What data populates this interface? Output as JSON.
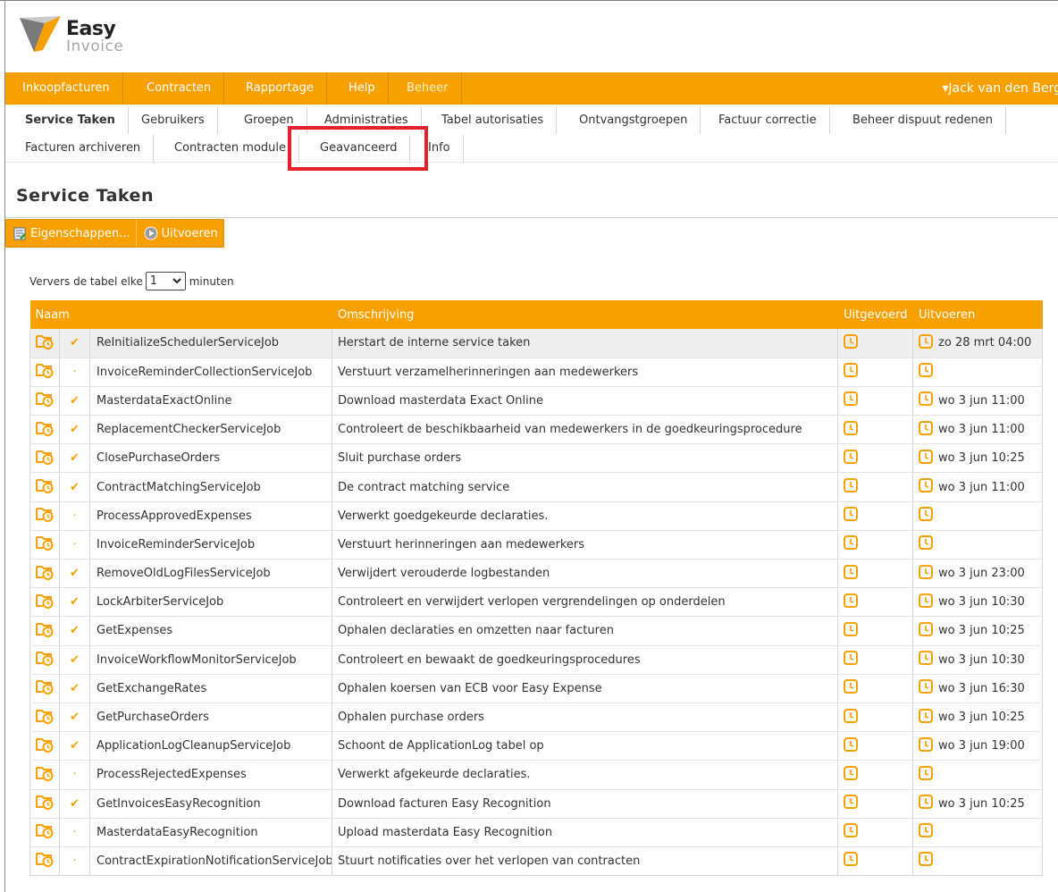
{
  "logo": {
    "line1": "Easy",
    "line2": "Invoice"
  },
  "colors": {
    "accent": "#f7a000",
    "highlight": "#e8202a"
  },
  "topnav": {
    "items": [
      "Inkoopfacturen",
      "Contracten",
      "Rapportage",
      "Help",
      "Beheer"
    ],
    "active": "Beheer",
    "user": "▾Jack van den Berg"
  },
  "subnav": {
    "row1": [
      "Service Taken",
      "Gebruikers",
      "Groepen",
      "Administraties",
      "Tabel autorisaties",
      "Ontvangstgroepen",
      "Factuur correctie",
      "Beheer dispuut redenen"
    ],
    "row2": [
      "Facturen archiveren",
      "Contracten module",
      "Geavanceerd",
      "Info"
    ],
    "active": "Service Taken",
    "highlighted": "Geavanceerd"
  },
  "page": {
    "title": "Service Taken"
  },
  "toolbar": {
    "properties_label": "Eigenschappen...",
    "run_label": "Uitvoeren"
  },
  "refresh": {
    "prefix": "Ververs de tabel elke",
    "value": "1",
    "suffix": "minuten"
  },
  "table": {
    "headers": {
      "name": "Naam",
      "description": "Omschrijving",
      "executed": "Uitgevoerd",
      "run": "Uitvoeren"
    },
    "rows": [
      {
        "enabled": true,
        "name": "ReInitializeSchedulerServiceJob",
        "description": "Herstart de interne service taken",
        "next_run": "zo 28 mrt 04:00"
      },
      {
        "enabled": false,
        "name": "InvoiceReminderCollectionServiceJob",
        "description": "Verstuurt verzamelherinneringen aan medewerkers",
        "next_run": ""
      },
      {
        "enabled": true,
        "name": "MasterdataExactOnline",
        "description": "Download masterdata Exact Online",
        "next_run": "wo 3 jun 11:00"
      },
      {
        "enabled": true,
        "name": "ReplacementCheckerServiceJob",
        "description": "Controleert de beschikbaarheid van medewerkers in de goedkeuringsprocedure",
        "next_run": "wo 3 jun 11:00"
      },
      {
        "enabled": true,
        "name": "ClosePurchaseOrders",
        "description": "Sluit purchase orders",
        "next_run": "wo 3 jun 10:25"
      },
      {
        "enabled": true,
        "name": "ContractMatchingServiceJob",
        "description": "De contract matching service",
        "next_run": "wo 3 jun 11:00"
      },
      {
        "enabled": false,
        "name": "ProcessApprovedExpenses",
        "description": "Verwerkt goedgekeurde declaraties.",
        "next_run": ""
      },
      {
        "enabled": false,
        "name": "InvoiceReminderServiceJob",
        "description": "Verstuurt herinneringen aan medewerkers",
        "next_run": ""
      },
      {
        "enabled": true,
        "name": "RemoveOldLogFilesServiceJob",
        "description": "Verwijdert verouderde logbestanden",
        "next_run": "wo 3 jun 23:00"
      },
      {
        "enabled": true,
        "name": "LockArbiterServiceJob",
        "description": "Controleert en verwijdert verlopen vergrendelingen op onderdelen",
        "next_run": "wo 3 jun 10:30"
      },
      {
        "enabled": true,
        "name": "GetExpenses",
        "description": "Ophalen declaraties en omzetten naar facturen",
        "next_run": "wo 3 jun 10:25"
      },
      {
        "enabled": true,
        "name": "InvoiceWorkflowMonitorServiceJob",
        "description": "Controleert en bewaakt de goedkeuringsprocedures",
        "next_run": "wo 3 jun 10:30"
      },
      {
        "enabled": true,
        "name": "GetExchangeRates",
        "description": "Ophalen koersen van ECB voor Easy Expense",
        "next_run": "wo 3 jun 16:30"
      },
      {
        "enabled": true,
        "name": "GetPurchaseOrders",
        "description": "Ophalen purchase orders",
        "next_run": "wo 3 jun 10:25"
      },
      {
        "enabled": true,
        "name": "ApplicationLogCleanupServiceJob",
        "description": "Schoont de ApplicationLog tabel op",
        "next_run": "wo 3 jun 19:00"
      },
      {
        "enabled": false,
        "name": "ProcessRejectedExpenses",
        "description": "Verwerkt afgekeurde declaraties.",
        "next_run": ""
      },
      {
        "enabled": true,
        "name": "GetInvoicesEasyRecognition",
        "description": "Download facturen Easy Recognition",
        "next_run": "wo 3 jun 10:25"
      },
      {
        "enabled": false,
        "name": "MasterdataEasyRecognition",
        "description": "Upload masterdata Easy Recognition",
        "next_run": ""
      },
      {
        "enabled": false,
        "name": "ContractExpirationNotificationServiceJob",
        "description": "Stuurt notificaties over het verlopen van contracten",
        "next_run": ""
      }
    ]
  }
}
